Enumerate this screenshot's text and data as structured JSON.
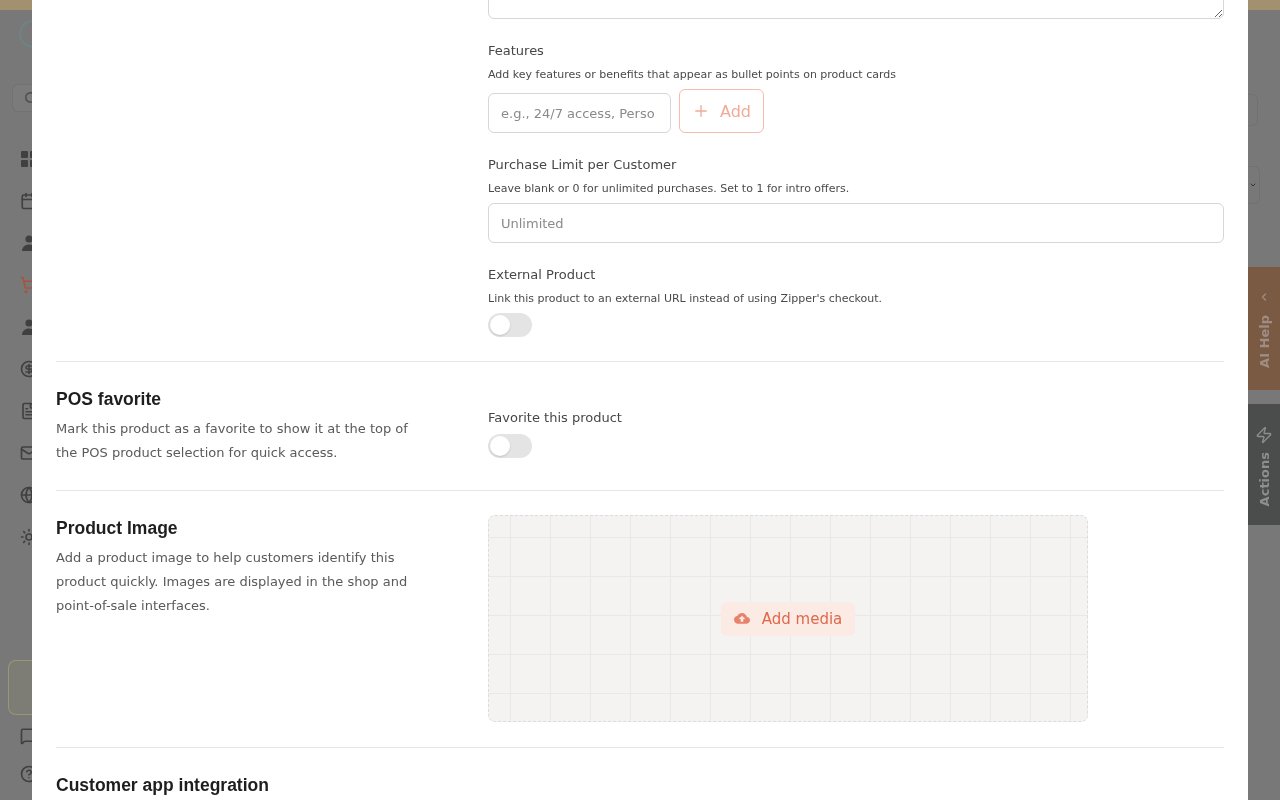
{
  "background": {
    "nav_items": [
      {
        "selected": false
      },
      {
        "selected": false
      },
      {
        "selected": false
      },
      {
        "selected": true
      },
      {
        "selected": false
      },
      {
        "selected": false
      },
      {
        "selected": false
      },
      {
        "selected": false
      },
      {
        "selected": false
      },
      {
        "selected": false
      }
    ],
    "side_tabs": [
      {
        "kind": "ai_help",
        "label": "AI Help"
      },
      {
        "kind": "actions",
        "label": "Actions"
      }
    ]
  },
  "product_form": {
    "fields": [
      {
        "kind": "textarea"
      },
      {
        "kind": "tag_input",
        "label": "Features",
        "hint": "Add key features or benefits that appear as bullet points on product cards",
        "placeholder": "e.g., 24/7 access, Perso",
        "button": {
          "label": "Add",
          "disabled": true
        }
      },
      {
        "kind": "text_input",
        "label": "Purchase Limit per Customer",
        "hint": "Leave blank or 0 for unlimited purchases. Set to 1 for intro offers.",
        "placeholder": "Unlimited"
      },
      {
        "kind": "toggle",
        "label": "External Product",
        "hint": "Link this product to an external URL instead of using Zipper's checkout.",
        "on": false
      }
    ],
    "sections": [
      {
        "kind": "toggle",
        "title": "POS favorite",
        "description": "Mark this product as a favorite to show it at the top of the POS product selection for quick access.",
        "field": {
          "label": "Favorite this product",
          "on": false
        }
      },
      {
        "kind": "media",
        "title": "Product Image",
        "description": "Add a product image to help customers identify this product quickly. Images are displayed in the shop and point-of-sale interfaces.",
        "button": {
          "label": "Add media"
        }
      },
      {
        "kind": "heading",
        "title": "Customer app integration"
      }
    ]
  }
}
